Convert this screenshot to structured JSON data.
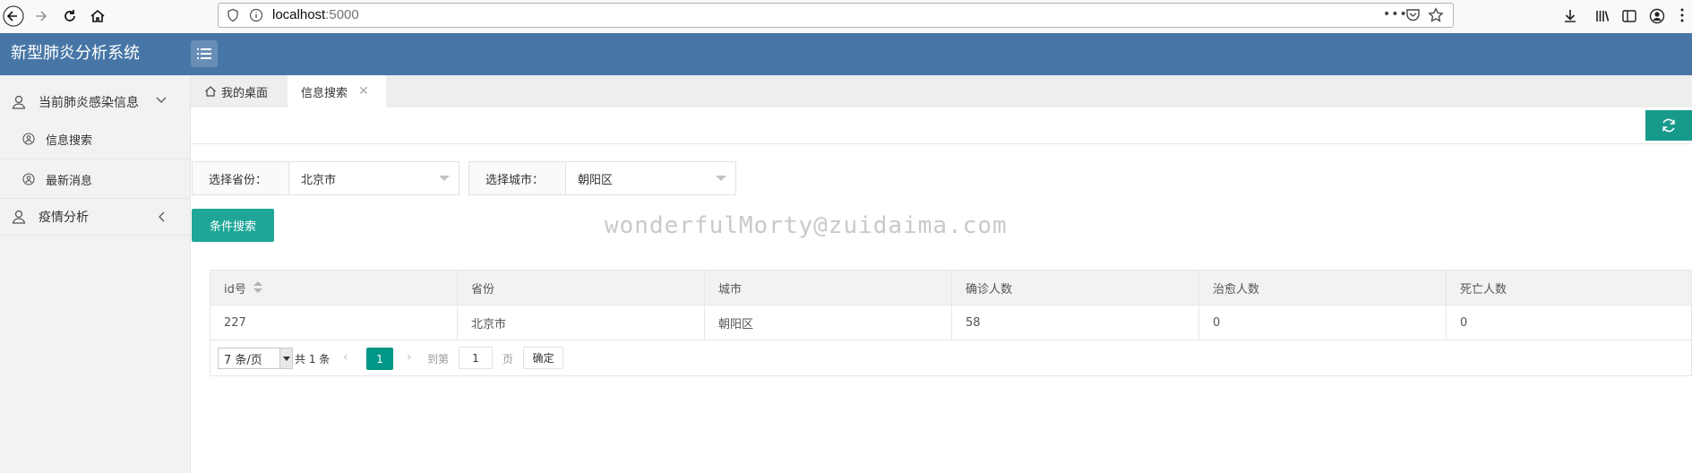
{
  "browser": {
    "url_host": "localhost",
    "url_port": ":5000"
  },
  "header": {
    "title": "新型肺炎分析系统"
  },
  "sidebar": {
    "groups": [
      {
        "label": "当前肺炎感染信息",
        "expanded": true,
        "items": [
          {
            "label": "信息搜索"
          },
          {
            "label": "最新消息"
          }
        ]
      },
      {
        "label": "疫情分析",
        "expanded": false
      }
    ]
  },
  "tabs": [
    {
      "label": "我的桌面",
      "icon": "home-icon"
    },
    {
      "label": "信息搜索",
      "active": true,
      "close": "✕"
    }
  ],
  "filters": {
    "province_label": "选择省份：",
    "province_value": "北京市",
    "city_label": "选择城市：",
    "city_value": "朝阳区",
    "search_button": "条件搜索"
  },
  "watermark": "wonderfulMorty@zuidaima.com",
  "table": {
    "columns": [
      "id号",
      "省份",
      "城市",
      "确诊人数",
      "治愈人数",
      "死亡人数"
    ],
    "rows": [
      [
        "227",
        "北京市",
        "朝阳区",
        "58",
        "0",
        "0"
      ]
    ]
  },
  "pager": {
    "limit": "7 条/页",
    "count": "共 1 条",
    "prev": "‹",
    "current": "1",
    "next": "›",
    "goto_label": "到第",
    "goto_value": "1",
    "page_label": "页",
    "confirm": "确定"
  },
  "colors": {
    "header": "#4776a6",
    "accent": "#009688"
  }
}
